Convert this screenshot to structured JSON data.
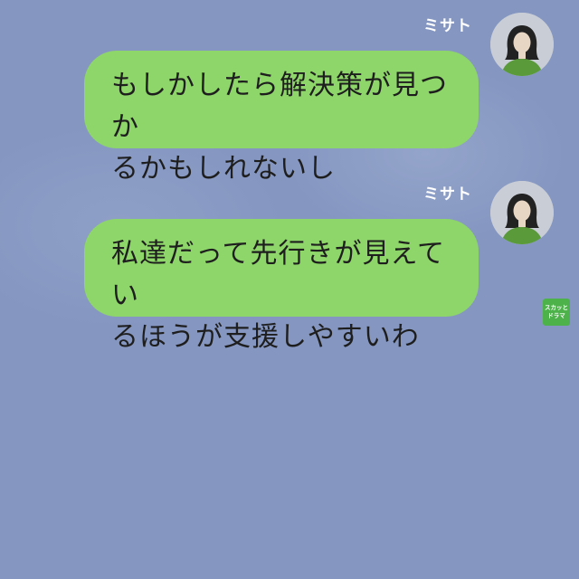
{
  "messages": [
    {
      "sender": "ミサト",
      "avatar_icon": "woman-avatar-icon",
      "lines": [
        "もしかしたら解決策が見つか",
        "るかもしれないし"
      ]
    },
    {
      "sender": "ミサト",
      "avatar_icon": "woman-avatar-icon",
      "lines": [
        "私達だって先行きが見えてい",
        "るほうが支援しやすいわ"
      ]
    }
  ],
  "watermark": {
    "line1": "スカッと",
    "line2": "ドラマ"
  },
  "colors": {
    "background": "#8597c1",
    "bubble": "#8ed56a",
    "text": "#1e1e1e",
    "watermark": "#4db24a"
  }
}
